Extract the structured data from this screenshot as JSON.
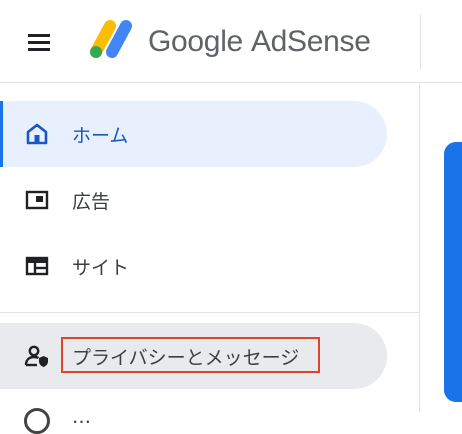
{
  "header": {
    "menu_icon": "hamburger-menu-icon",
    "logo_icon": "adsense-logo-icon",
    "brand_google": "Google",
    "brand_product": "AdSense"
  },
  "sidebar": {
    "items": [
      {
        "label": "ホーム",
        "icon": "home-icon",
        "active": true
      },
      {
        "label": "広告",
        "icon": "ad-unit-icon",
        "active": false
      },
      {
        "label": "サイト",
        "icon": "sites-icon",
        "active": false
      },
      {
        "label": "プライバシーとメッセージ",
        "icon": "privacy-person-icon",
        "active": false,
        "hovered": true
      },
      {
        "label": "…",
        "icon": "circle-icon",
        "active": false,
        "partially_visible": true
      }
    ]
  },
  "colors": {
    "accent": "#1a73e8",
    "active_bg": "#e8f0fe",
    "hover_bg": "#e8eaed",
    "highlight_border": "#e0452c",
    "logo_yellow": "#fbbc04",
    "logo_blue": "#4285f4",
    "logo_green": "#34a853"
  }
}
